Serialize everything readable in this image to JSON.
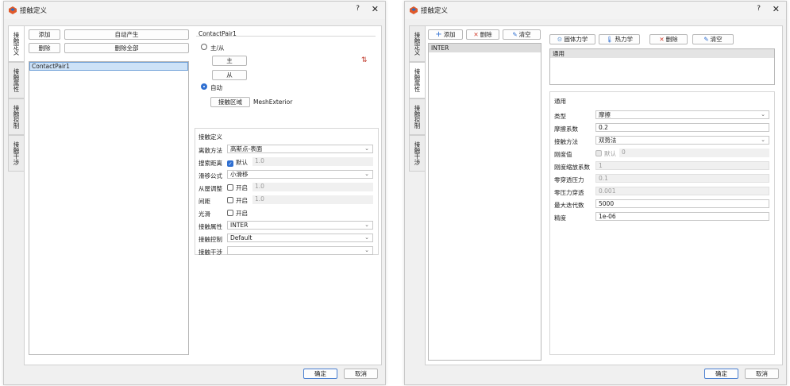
{
  "left": {
    "title": "接触定义",
    "help": "?",
    "close": "✕",
    "tabs": [
      "接触定义",
      "接触属性",
      "接触控制",
      "接触干涉"
    ],
    "buttons": {
      "add": "添加",
      "auto": "自动产生",
      "delete": "删除",
      "delete_all": "删除全部"
    },
    "list": [
      "ContactPair1"
    ],
    "pair": {
      "group_title": "ContactPair1",
      "master_slave": "主/从",
      "master": "主",
      "slave": "从",
      "swap_icon": "⇅",
      "auto": "自动",
      "region_btn": "接触区域",
      "region_value": "MeshExterior"
    },
    "def": {
      "group_title": "接触定义",
      "rows": [
        {
          "label": "离散方法",
          "value": "高斯点-表面"
        },
        {
          "label": "搜索距离",
          "check": "默认",
          "value": "1.0"
        },
        {
          "label": "滑移公式",
          "value": "小滑移"
        },
        {
          "label": "从屋调整",
          "check": "开启",
          "value": "1.0"
        },
        {
          "label": "间距",
          "check": "开启",
          "value": "1.0"
        },
        {
          "label": "光滑",
          "check": "开启"
        },
        {
          "label": "接触属性",
          "value": "INTER"
        },
        {
          "label": "接触控制",
          "value": "Default"
        },
        {
          "label": "接触干涉",
          "value": ""
        }
      ]
    },
    "ok": "确定",
    "cancel": "取消"
  },
  "right": {
    "title": "接触定义",
    "help": "?",
    "close": "✕",
    "tabs": [
      "接触定义",
      "接触属性",
      "接触控制",
      "接触干涉"
    ],
    "toolbar": {
      "add": "添加",
      "delete": "删除",
      "clear": "清空"
    },
    "list": [
      "INTER"
    ],
    "type_toolbar": {
      "solid": "固体力学",
      "thermal": "热力学",
      "delete": "删除",
      "clear": "清空"
    },
    "types_header": "通用",
    "general": {
      "group_title": "通用",
      "rows": [
        {
          "label": "类型",
          "value": "摩擦"
        },
        {
          "label": "摩擦系数",
          "value": "0.2"
        },
        {
          "label": "接触方法",
          "value": "双势法"
        },
        {
          "label": "刚度值",
          "check": "默认",
          "value": "0"
        },
        {
          "label": "刚度缩放系数",
          "value": "1"
        },
        {
          "label": "零穿透压力",
          "value": "0.1"
        },
        {
          "label": "零压力穿透",
          "value": "0.001"
        },
        {
          "label": "最大迭代数",
          "value": "5000"
        },
        {
          "label": "精度",
          "value": "1e-06"
        }
      ]
    },
    "ok": "确定",
    "cancel": "取消"
  }
}
